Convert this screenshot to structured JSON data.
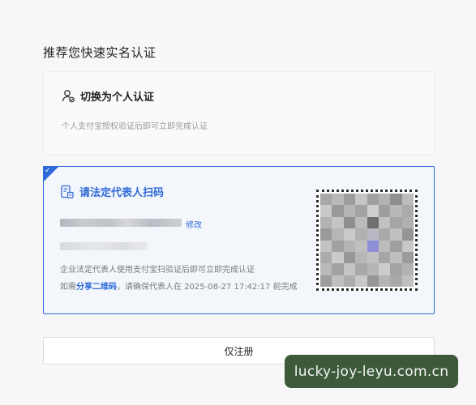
{
  "page": {
    "title": "推荐您快速实名认证"
  },
  "personal_option": {
    "icon": "user-verify-icon",
    "label": "切换为个人认证",
    "description": "个人支付宝授权验证后即可立即完成认证"
  },
  "legal_option": {
    "selected": true,
    "icon": "document-scan-icon",
    "label": "请法定代表人扫码",
    "edit_label": "修改",
    "description": "企业法定代表人使用支付宝扫验证后即可立即完成认证",
    "note_prefix": "如需",
    "share_link": "分享二维码",
    "note_suffix": "，请确保代表人在 2025-08-27 17:42:17 前完成"
  },
  "register_button": {
    "label": "仅注册"
  },
  "watermark": {
    "text": "lucky-joy-leyu.com.cn"
  },
  "colors": {
    "accent": "#2f6bd8",
    "watermark_bg": "#3c5a3a"
  }
}
